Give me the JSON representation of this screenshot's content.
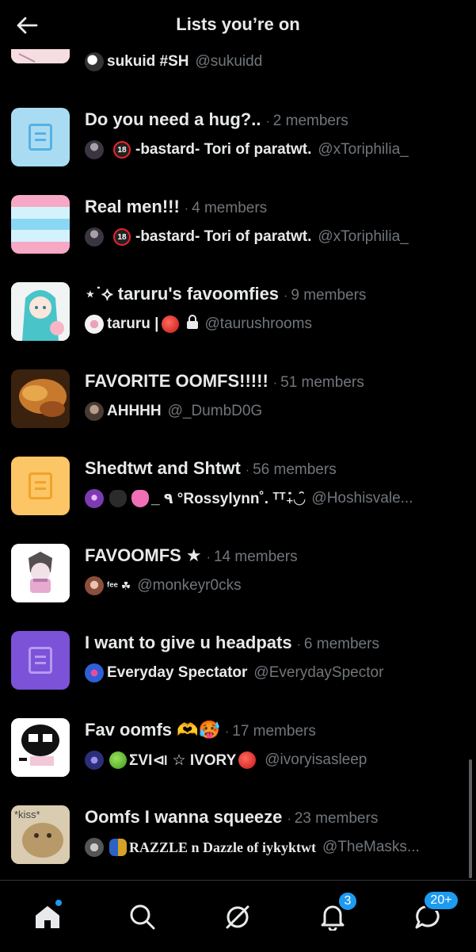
{
  "header": {
    "title": "Lists you’re on"
  },
  "lists": [
    {
      "name": "",
      "members": "",
      "owner_name": "sukuid #SH",
      "owner_handle": "@sukuidd",
      "thumb": "image",
      "thumb_color": "#f4d7de"
    },
    {
      "name": "Do you need a hug?..",
      "members": "2 members",
      "owner_name": "-bastard- Tori of paratwt.",
      "owner_handle": "@xToriphilia_",
      "thumb": "list-icon",
      "thumb_color": "#a9dcf3",
      "icon_color": "#58b0e3"
    },
    {
      "name": "Real men!!!",
      "members": "4 members",
      "owner_name": "-bastard- Tori of paratwt.",
      "owner_handle": "@xToriphilia_",
      "thumb": "stripes",
      "thumb_color": "#f7a8c4"
    },
    {
      "name": "⋆˙⟡ taruru's favoomfies",
      "members": "9 members",
      "owner_name": "taruru |",
      "owner_handle": "@taurushrooms",
      "thumb": "image",
      "thumb_color": "#cfe8ec"
    },
    {
      "name": "FAVORITE OOMFS!!!!!",
      "members": "51 members",
      "owner_name": "AHHHH",
      "owner_handle": "@_DumbD0G",
      "thumb": "image",
      "thumb_color": "#a0632a"
    },
    {
      "name": "Shedtwt and Shtwt",
      "members": "56 members",
      "owner_name": "_ ٩ °Rossylynn˚. ᵀᵀ₊̇◡̑",
      "owner_handle": "@Hoshisvale...",
      "thumb": "list-icon",
      "thumb_color": "#fcc566",
      "icon_color": "#f0a32a"
    },
    {
      "name": "FAVOOMFS ★",
      "members": "14 members",
      "owner_name": "ᶠᵉᵉ ☘",
      "owner_handle": "@monkeyr0cks",
      "thumb": "image",
      "thumb_color": "#ffffff"
    },
    {
      "name": "I want to give u headpats",
      "members": "6 members",
      "owner_name": "Everyday Spectator",
      "owner_handle": "@EverydaySpector",
      "thumb": "list-icon",
      "thumb_color": "#7c52d9",
      "icon_color": "#b59bf0"
    },
    {
      "name": "Fav oomfs 🫶🥵",
      "members": "17 members",
      "owner_name": "ΣVI⧏ ☆ IVORY",
      "owner_handle": "@ivoryisasleep",
      "thumb": "image",
      "thumb_color": "#ffffff"
    },
    {
      "name": "Oomfs I wanna squeeze",
      "members": "23 members",
      "owner_name": "RAZZLE n Dazzle of iykyktwt",
      "owner_handle": "@TheMasks...",
      "thumb": "image",
      "thumb_color": "#d6c9ac",
      "thumb_text": "*kiss*"
    }
  ],
  "bottom_nav": {
    "notifications_badge": "3",
    "messages_badge": "20+"
  },
  "icons": [
    "back-arrow-icon",
    "home-icon",
    "search-icon",
    "grok-icon",
    "bell-icon",
    "messages-icon"
  ]
}
